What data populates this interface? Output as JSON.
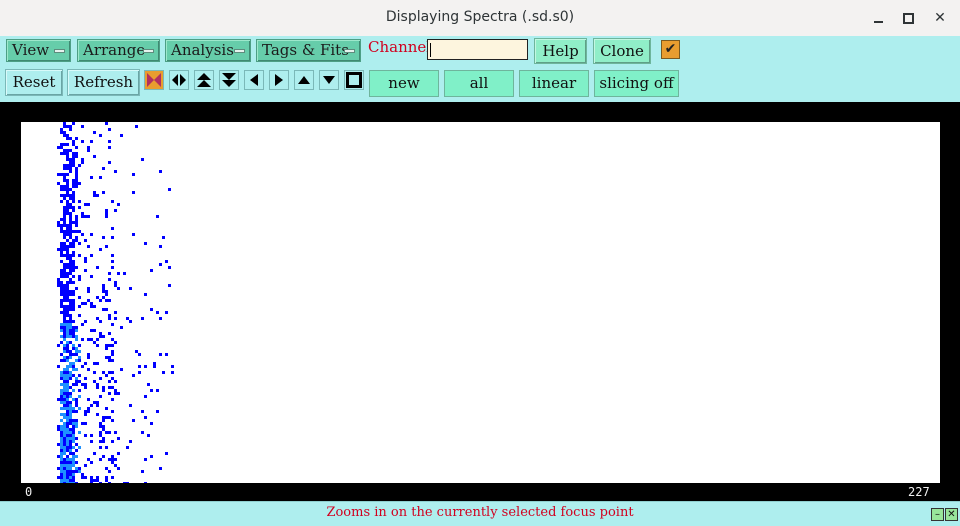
{
  "window": {
    "title": "Displaying Spectra (.sd.s0)"
  },
  "menus": [
    {
      "label": "View"
    },
    {
      "label": "Arrange"
    },
    {
      "label": "Analysis"
    },
    {
      "label": "Tags & Fits"
    }
  ],
  "channel": {
    "label": "Channel:",
    "value": ""
  },
  "buttons": {
    "help": "Help",
    "clone": "Clone",
    "reset": "Reset",
    "refresh": "Refresh",
    "new": "new",
    "all": "all",
    "linear": "linear",
    "slicing": "slicing off"
  },
  "icons": {
    "focus": "zoom-focus-icon",
    "expand_horizontal": "expand-horizontal-icon",
    "expand_up": "expand-up-icon",
    "expand_down": "expand-down-icon",
    "left": "arrow-left-icon",
    "right": "arrow-right-icon",
    "up": "arrow-up-icon",
    "down": "arrow-down-icon",
    "box": "square-icon"
  },
  "plot": {
    "x_min_label": "0",
    "x_max_label": "227"
  },
  "status": {
    "message": "Zooms in on the currently selected focus point"
  },
  "colors": {
    "toolbar_bg": "#aeeeee",
    "menu_bg": "#66cdaa",
    "data_dark": "#0000ff",
    "data_light": "#1e90ff",
    "accent_red": "#d1001f",
    "check_orange": "#e89d2f"
  }
}
